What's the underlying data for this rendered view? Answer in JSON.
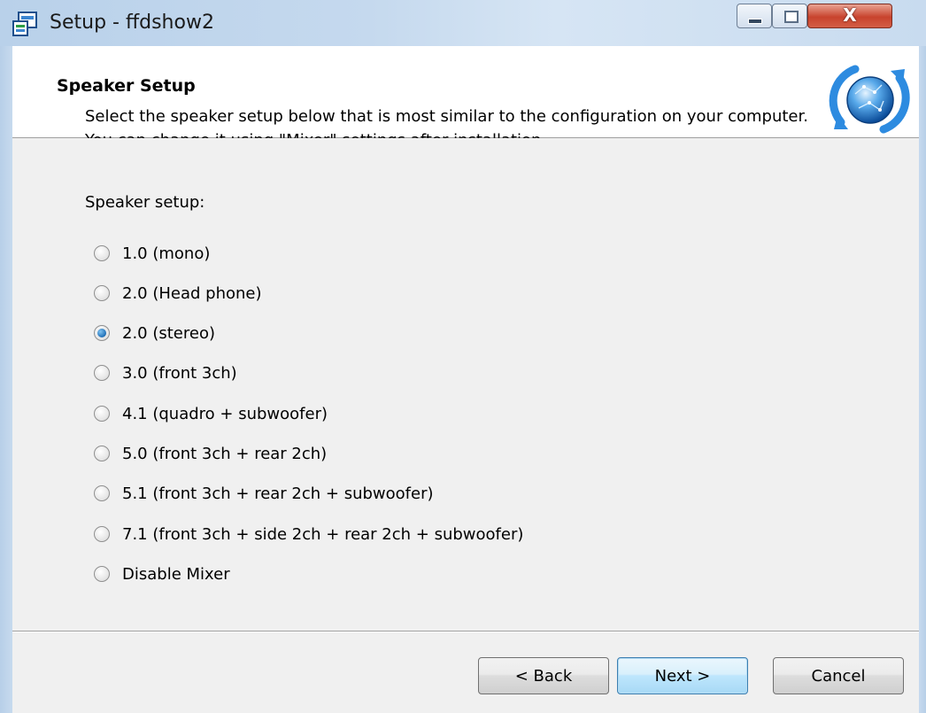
{
  "window": {
    "title": "Setup - ffdshow2",
    "close_glyph": "X"
  },
  "header": {
    "title": "Speaker Setup",
    "description": "Select the speaker setup below that is most similar to the configuration on your computer. You can change it using \"Mixer\" settings after installation."
  },
  "speaker_setup": {
    "label": "Speaker setup:",
    "selected": "2.0 (stereo)",
    "options": [
      "1.0 (mono)",
      "2.0 (Head phone)",
      "2.0 (stereo)",
      "3.0 (front 3ch)",
      "4.1 (quadro + subwoofer)",
      "5.0 (front 3ch + rear 2ch)",
      "5.1 (front 3ch + rear 2ch + subwoofer)",
      "7.1 (front 3ch + side 2ch + rear 2ch + subwoofer)",
      "Disable Mixer"
    ]
  },
  "buttons": {
    "back": "< Back",
    "next": "Next >",
    "cancel": "Cancel"
  },
  "icons": {
    "app": "setup-package-icon",
    "wizard": "globe-refresh-icon",
    "minimize": "minimize-icon",
    "maximize": "maximize-icon",
    "close": "close-icon"
  },
  "colors": {
    "titlebar": "#c5d9ee",
    "close_button": "#c8432d",
    "radio_selected": "#1f6fb7",
    "default_button_border": "#3c7fb1"
  }
}
